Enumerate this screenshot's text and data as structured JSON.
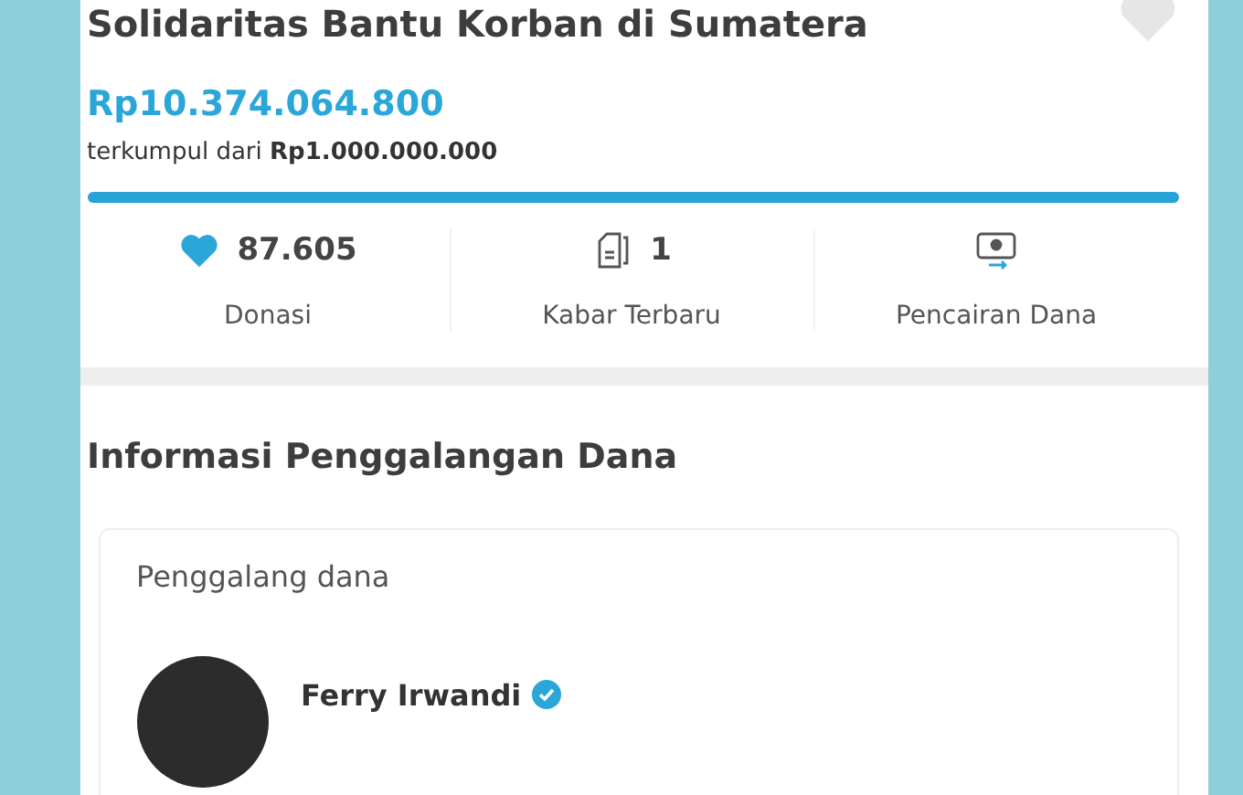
{
  "campaign": {
    "title": "Solidaritas Bantu Korban di Sumatera",
    "favorited": false,
    "collected": "Rp10.374.064.800",
    "target_prefix": "terkumpul dari",
    "target": "Rp1.000.000.000",
    "level": 1
  },
  "stats": [
    {
      "kind": "donations",
      "value": "87.605",
      "label": "Donasi"
    },
    {
      "kind": "updates",
      "value": "1",
      "label": "Kabar Terbaru"
    },
    {
      "kind": "withdrawals",
      "label": "Pencairan Dana"
    }
  ],
  "info": {
    "heading": "Informasi Penggalangan Dana",
    "card_label": "Penggalang dana",
    "organizer": {
      "name": "Ferry Irwandi",
      "verified": true
    }
  }
}
